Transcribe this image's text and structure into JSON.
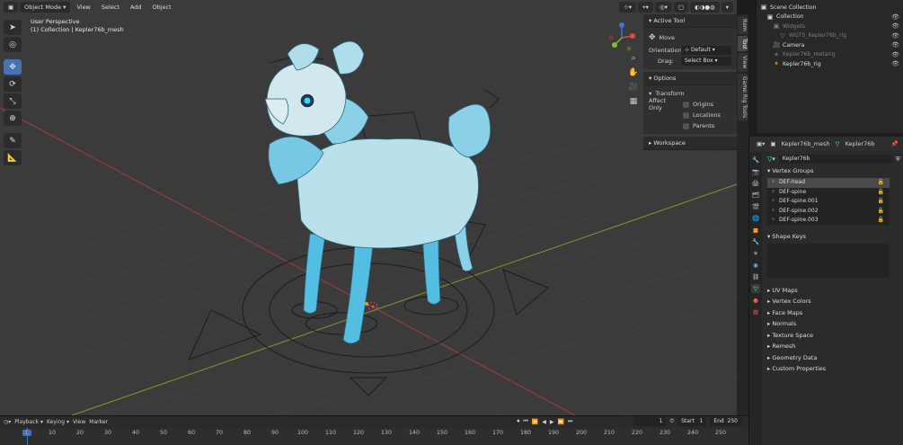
{
  "viewport": {
    "mode": "Object Mode",
    "menus": [
      "View",
      "Select",
      "Add",
      "Object"
    ],
    "info_line1": "User Perspective",
    "info_line2": "(1) Collection | Kepler76b_mesh"
  },
  "npanel": {
    "active_tool_title": "Active Tool",
    "tool_name": "Move",
    "orientation_label": "Orientation",
    "orientation_value": "Default",
    "drag_label": "Drag:",
    "drag_value": "Select Box",
    "options_title": "Options",
    "transform_title": "Transform",
    "affect_only_label": "Affect Only",
    "affect_origins": "Origins",
    "affect_locations": "Locations",
    "affect_parents": "Parents",
    "workspace_title": "Workspace",
    "tabs": [
      "Item",
      "Tool",
      "View",
      "Game Rig Tools"
    ]
  },
  "outliner": {
    "rows": [
      {
        "label": "Scene Collection",
        "indent": 0,
        "dim": false
      },
      {
        "label": "Collection",
        "indent": 1,
        "dim": false
      },
      {
        "label": "Widgets",
        "indent": 2,
        "dim": true
      },
      {
        "label": "WGTS_Kepler76b_rig",
        "indent": 3,
        "dim": true
      },
      {
        "label": "Camera",
        "indent": 2,
        "dim": false
      },
      {
        "label": "Kepler76b_metarig",
        "indent": 2,
        "dim": true
      },
      {
        "label": "Kepler76b_rig",
        "indent": 2,
        "dim": false
      }
    ]
  },
  "props": {
    "object_name": "Kepler76b_mesh",
    "data_name": "Kepler76b",
    "mesh_field": "Kepler76b",
    "vertex_groups_title": "Vertex Groups",
    "vertex_groups": [
      "DEF-head",
      "DEF-spine",
      "DEF-spine.001",
      "DEF-spine.002",
      "DEF-spine.003"
    ],
    "shape_keys_title": "Shape Keys",
    "panels": [
      "UV Maps",
      "Vertex Colors",
      "Face Maps",
      "Normals",
      "Texture Space",
      "Remesh",
      "Geometry Data",
      "Custom Properties"
    ]
  },
  "timeline": {
    "menus": [
      "Playback",
      "Keying",
      "View",
      "Marker"
    ],
    "current_frame": "1",
    "start_label": "Start",
    "start_value": "1",
    "end_label": "End",
    "end_value": "250",
    "ticks": [
      "1",
      "10",
      "20",
      "30",
      "40",
      "50",
      "60",
      "70",
      "80",
      "90",
      "100",
      "110",
      "120",
      "130",
      "140",
      "150",
      "160",
      "170",
      "180",
      "190",
      "200",
      "210",
      "220",
      "230",
      "240",
      "250"
    ]
  },
  "colors": {
    "accent": "#4772b3",
    "mesh": "#4fc8ec",
    "x_axis": "#a33c3c",
    "y_axis": "#7d9a2a"
  }
}
